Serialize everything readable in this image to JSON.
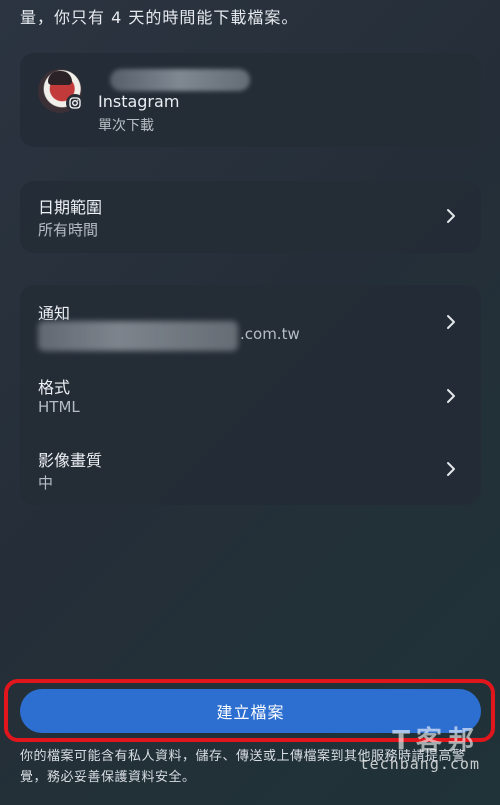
{
  "intro_text": "量，你只有 4 天的時間能下載檔案。",
  "account": {
    "platform": "Instagram",
    "download_type": "單次下載"
  },
  "date_range": {
    "title": "日期範圍",
    "value": "所有時間"
  },
  "options": {
    "notify": {
      "title": "通知",
      "value": ".com.tw"
    },
    "format": {
      "title": "格式",
      "value": "HTML"
    },
    "quality": {
      "title": "影像畫質",
      "value": "中"
    }
  },
  "create_button": "建立檔案",
  "footer_note": "你的檔案可能含有私人資料，儲存、傳送或上傳檔案到其他服務時請提高警覺，務必妥善保護資料安全。",
  "watermark": {
    "main": "T客邦",
    "sub": "techbang.com"
  },
  "colors": {
    "accent": "#2d6fd0",
    "highlight": "#e0161c"
  }
}
